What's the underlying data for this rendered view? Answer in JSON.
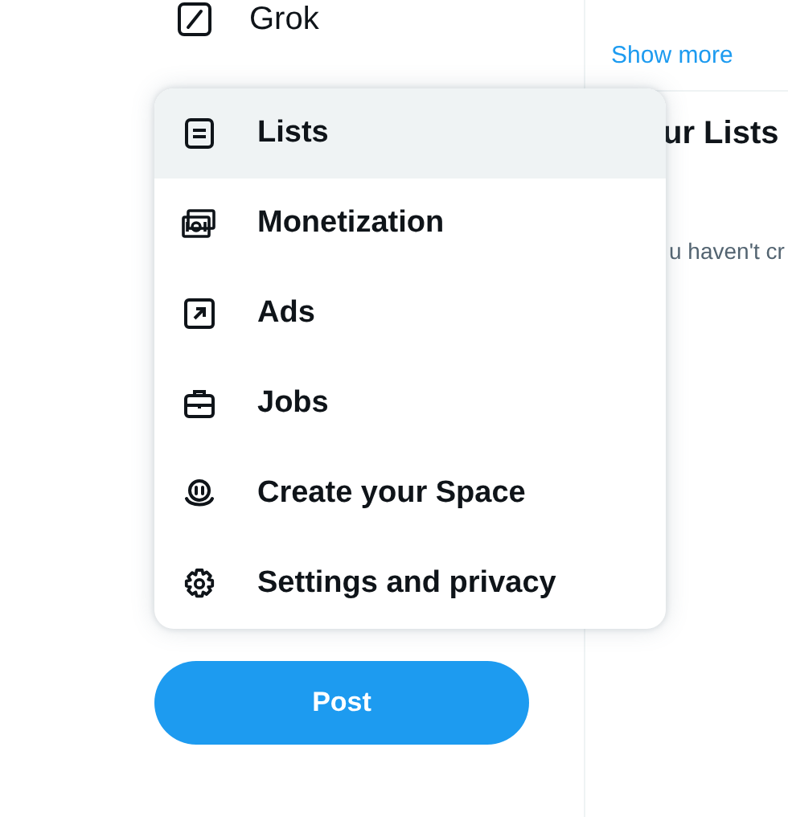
{
  "nav": {
    "label": "Grok"
  },
  "more_menu": {
    "items": [
      {
        "kind": "lists",
        "label": "Lists",
        "selected": true
      },
      {
        "kind": "monetization",
        "label": "Monetization",
        "selected": false
      },
      {
        "kind": "ads",
        "label": "Ads",
        "selected": false
      },
      {
        "kind": "jobs",
        "label": "Jobs",
        "selected": false
      },
      {
        "kind": "spaces",
        "label": "Create your Space",
        "selected": false
      },
      {
        "kind": "settings",
        "label": "Settings and privacy",
        "selected": false
      }
    ]
  },
  "post_button": "Post",
  "right_panel": {
    "show_more": "Show more",
    "lists_heading": "ur Lists",
    "lists_empty": "u haven't cr"
  }
}
